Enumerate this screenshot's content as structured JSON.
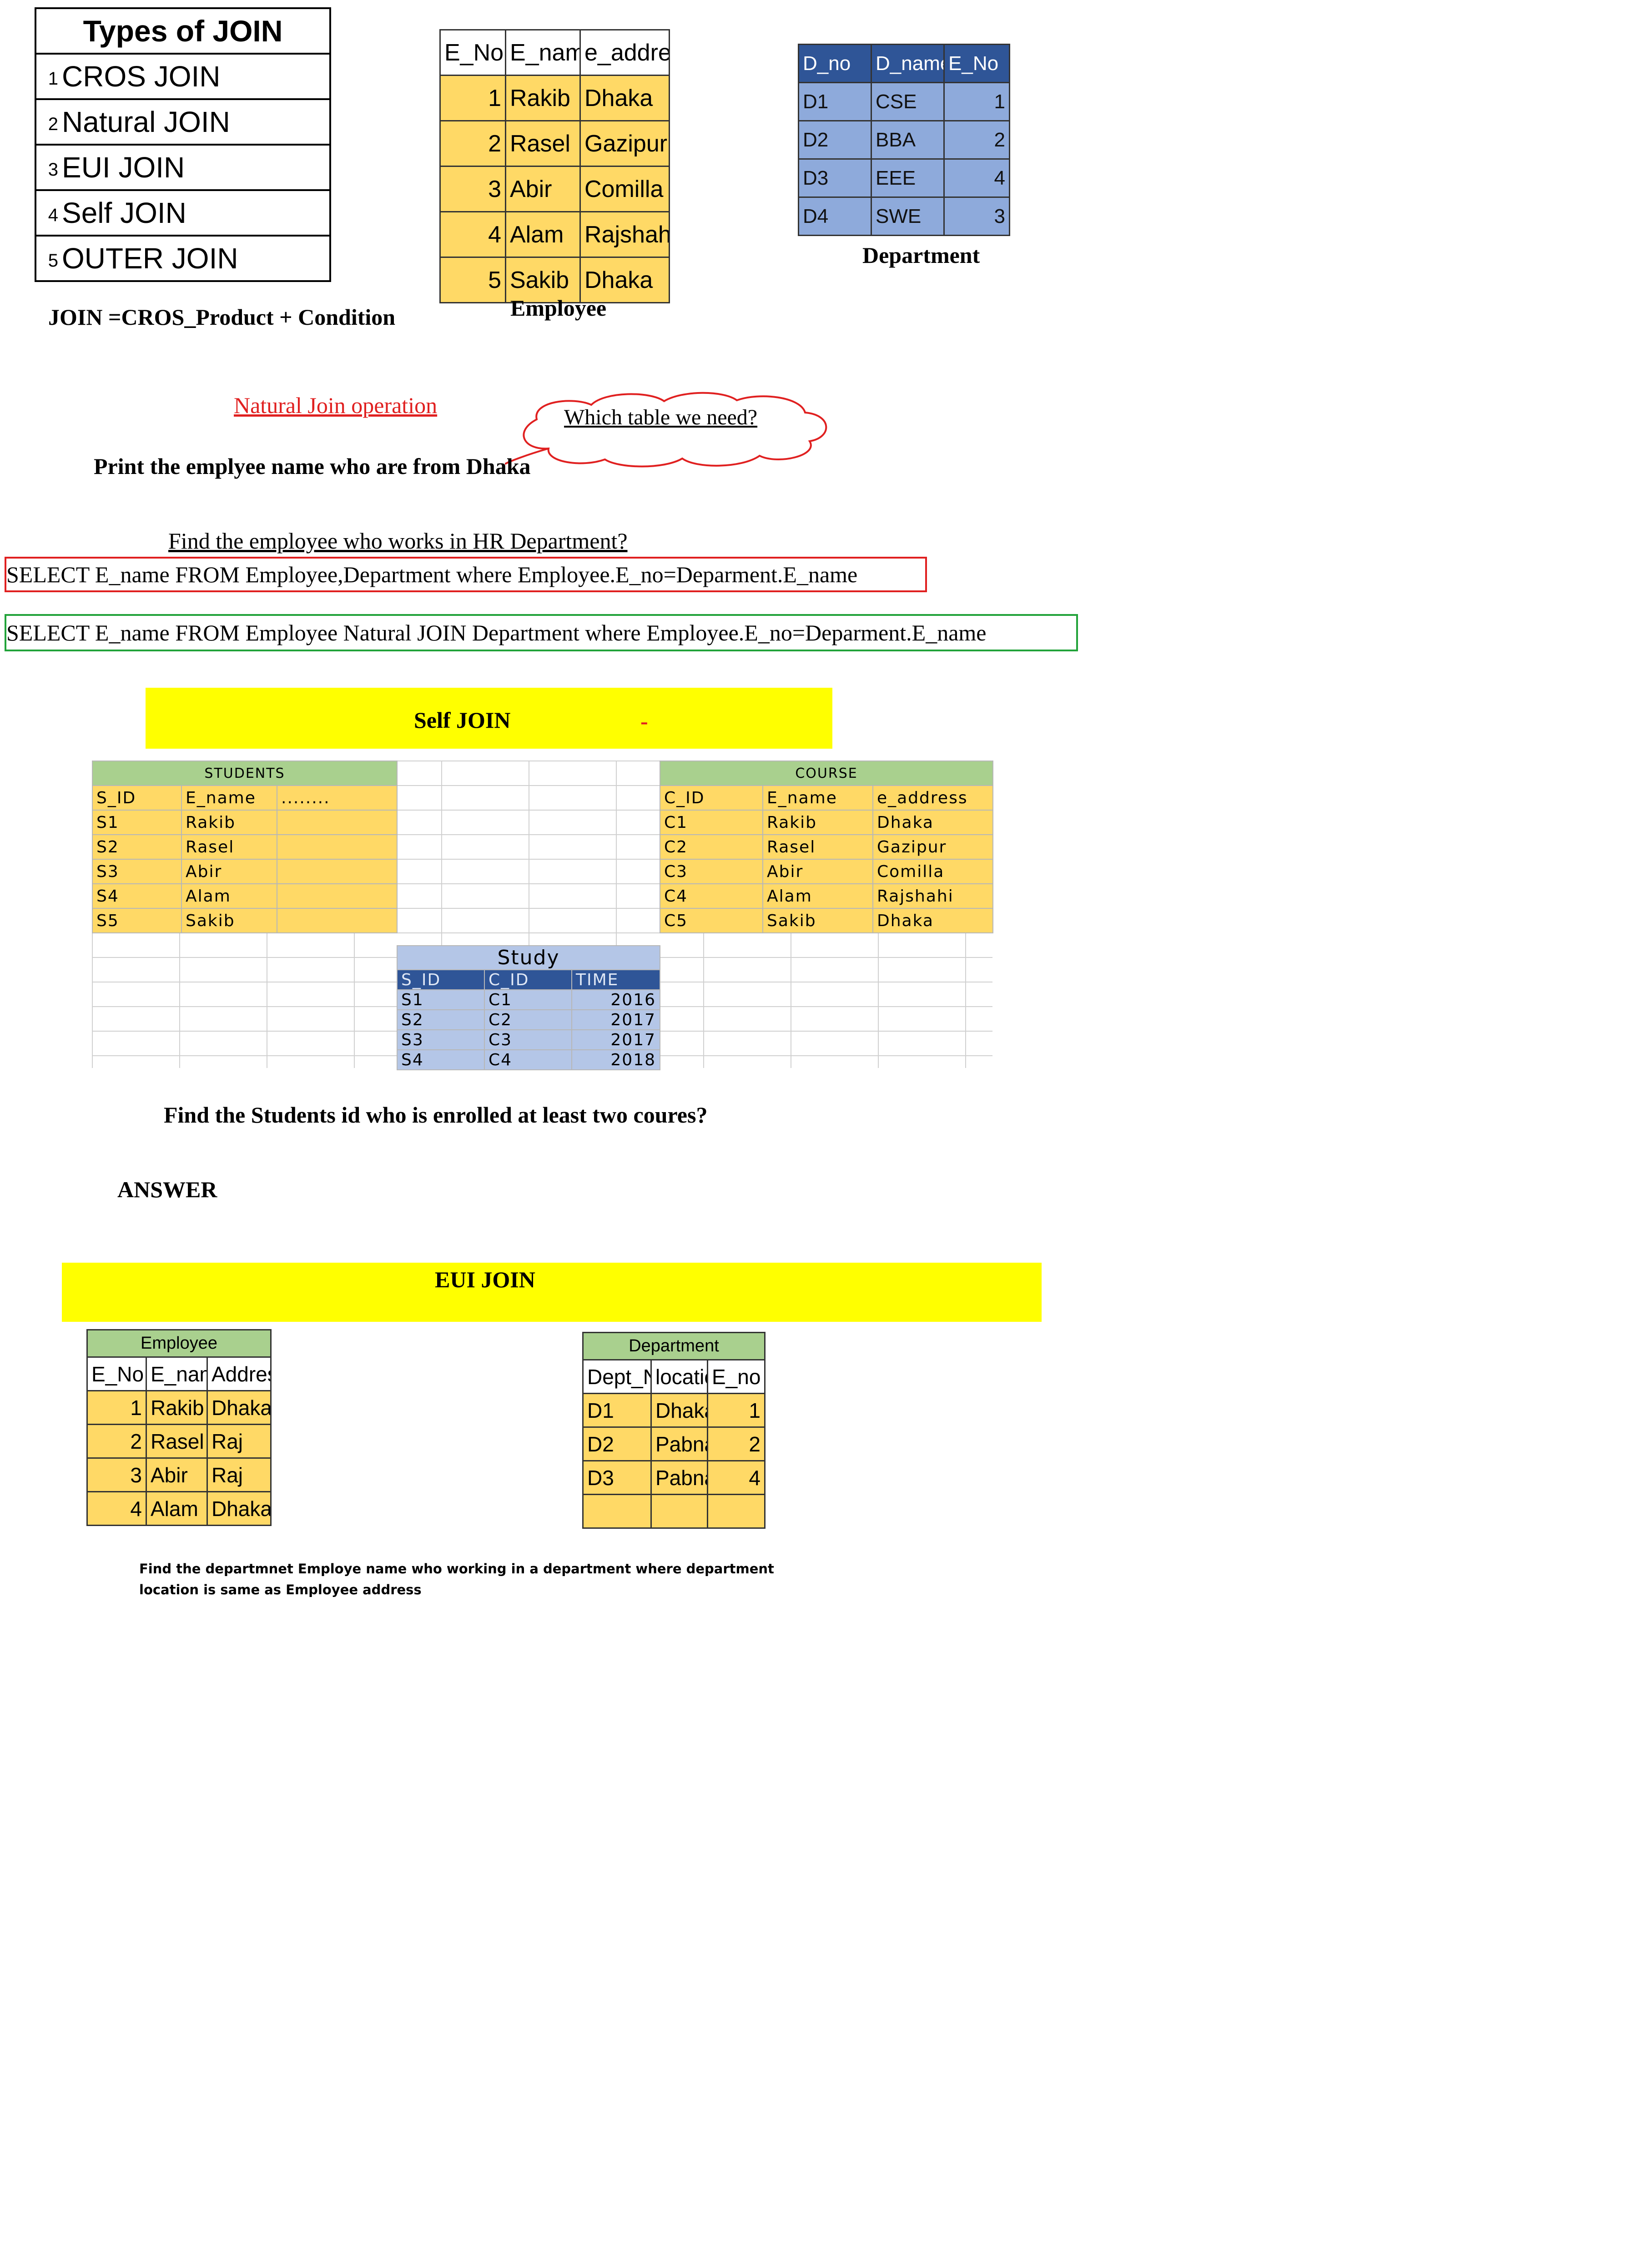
{
  "types_of_join": {
    "title": "Types of JOIN",
    "items": [
      {
        "n": "1",
        "label": "CROS JOIN"
      },
      {
        "n": "2",
        "label": "Natural JOIN"
      },
      {
        "n": "3",
        "label": "EUI JOIN"
      },
      {
        "n": "4",
        "label": "Self JOIN"
      },
      {
        "n": "5",
        "label": "OUTER JOIN"
      }
    ]
  },
  "join_formula": "JOIN =CROS_Product + Condition",
  "employee_table": {
    "caption": "Employee",
    "headers": [
      "E_No",
      "E_name",
      "e_address"
    ],
    "rows": [
      [
        "1",
        "Rakib",
        "Dhaka"
      ],
      [
        "2",
        "Rasel",
        "Gazipur"
      ],
      [
        "3",
        "Abir",
        "Comilla"
      ],
      [
        "4",
        "Alam",
        "Rajshahi"
      ],
      [
        "5",
        "Sakib",
        "Dhaka"
      ]
    ]
  },
  "department_table": {
    "caption": "Department",
    "headers": [
      "D_no",
      "D_name",
      "E_No"
    ],
    "rows": [
      [
        "D1",
        "CSE",
        "1"
      ],
      [
        "D2",
        "BBA",
        "2"
      ],
      [
        "D3",
        "EEE",
        "4"
      ],
      [
        "D4",
        "SWE",
        "3"
      ]
    ]
  },
  "natural_join_label": "Natural Join operation",
  "cloud_text": "Which table we need?",
  "print_question": "Print the emplyee name who are from Dhaka",
  "hr_question": "Find the employee who works in HR Department?",
  "sql_1": "SELECT E_name FROM  Employee,Department where Employee.E_no=Deparment.E_name",
  "sql_2": "SELECT E_name FROM  Employee Natural JOIN Department where Employee.E_no=Deparment.E_name",
  "self_join_banner": "Self JOIN",
  "self_join_dash": "-",
  "students": {
    "caption": "STUDENTS",
    "headers": [
      "S_ID",
      "E_name",
      "........"
    ],
    "rows": [
      [
        "S1",
        "Rakib"
      ],
      [
        "S2",
        "Rasel"
      ],
      [
        "S3",
        "Abir"
      ],
      [
        "S4",
        "Alam"
      ],
      [
        "S5",
        "Sakib"
      ]
    ]
  },
  "course": {
    "caption": "COURSE",
    "headers": [
      "C_ID",
      "E_name",
      "e_address"
    ],
    "rows": [
      [
        "C1",
        "Rakib",
        "Dhaka"
      ],
      [
        "C2",
        "Rasel",
        "Gazipur"
      ],
      [
        "C3",
        "Abir",
        "Comilla"
      ],
      [
        "C4",
        "Alam",
        "Rajshahi"
      ],
      [
        "C5",
        "Sakib",
        "Dhaka"
      ]
    ]
  },
  "study": {
    "caption": "Study",
    "headers": [
      "S_ID",
      "C_ID",
      "TIME"
    ],
    "rows": [
      [
        "S1",
        "C1",
        "2016"
      ],
      [
        "S2",
        "C2",
        "2017"
      ],
      [
        "S3",
        "C3",
        "2017"
      ],
      [
        "S4",
        "C4",
        "2018"
      ]
    ]
  },
  "students_question": "Find the Students id who is enrolled at least two coures?",
  "answer_label": "ANSWER",
  "eui_join_banner": "EUI JOIN",
  "employee2": {
    "caption": "Employee",
    "headers": [
      "E_No",
      "E_name",
      "Address"
    ],
    "rows": [
      [
        "1",
        "Rakib",
        "Dhaka"
      ],
      [
        "2",
        "Rasel",
        "Raj"
      ],
      [
        "3",
        "Abir",
        "Raj"
      ],
      [
        "4",
        "Alam",
        "Dhaka"
      ]
    ]
  },
  "department2": {
    "caption": "Department",
    "headers": [
      "Dept_No",
      "location",
      "E_no"
    ],
    "rows": [
      [
        "D1",
        "Dhaka",
        "1"
      ],
      [
        "D2",
        "Pabna",
        "2"
      ],
      [
        "D3",
        "Pabna",
        "4"
      ]
    ]
  },
  "eui_question_line1": "Find the departmnet Employe name who working in a department where department",
  "eui_question_line2": "location  is same as Employee address",
  "colors": {
    "yellow_banner": "#ffff00",
    "cell_yellow": "#ffd966",
    "header_green": "#a9d08e",
    "header_blue": "#2f5597",
    "cell_blue": "#8eaadb",
    "red_box": "#e02020",
    "green_box": "#22a33a"
  }
}
